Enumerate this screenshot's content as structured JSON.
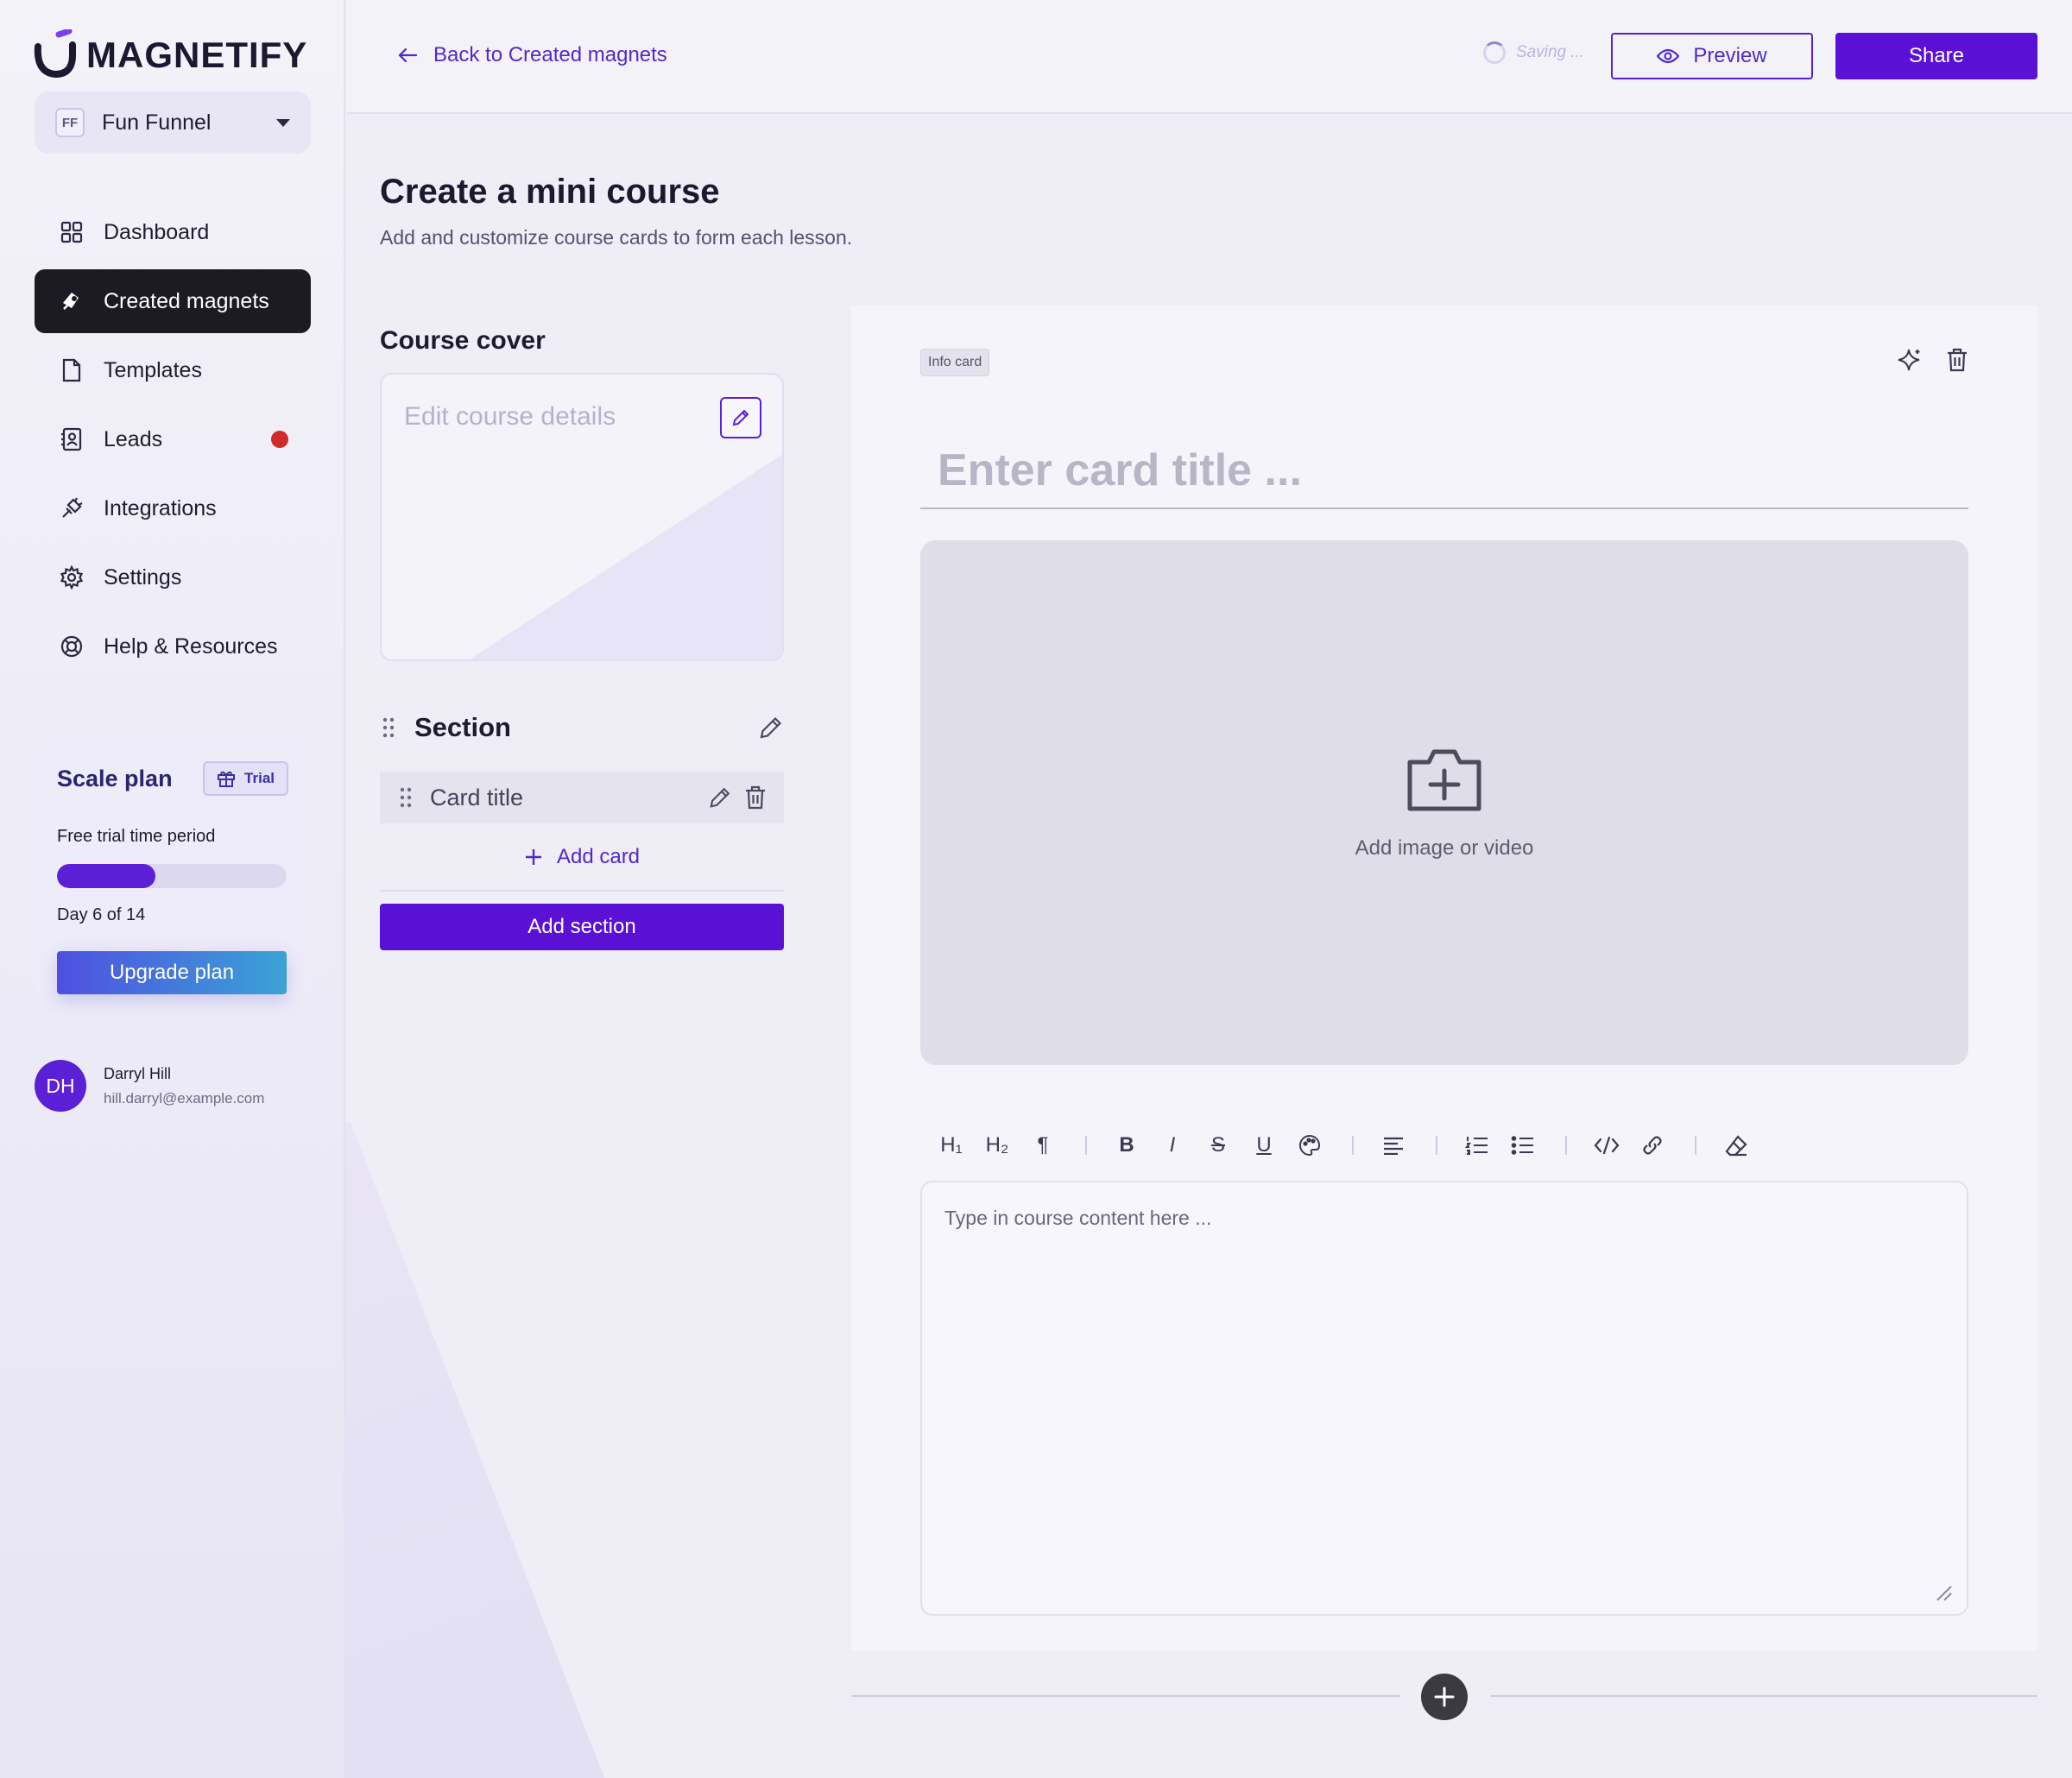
{
  "brand": {
    "name": "MAGNETIFY",
    "accent": "#5b10d6"
  },
  "workspace": {
    "initials": "FF",
    "name": "Fun Funnel"
  },
  "nav": {
    "items": [
      {
        "label": "Dashboard",
        "icon": "grid-icon",
        "active": false
      },
      {
        "label": "Created magnets",
        "icon": "magnet-icon",
        "active": true
      },
      {
        "label": "Templates",
        "icon": "document-icon",
        "active": false
      },
      {
        "label": "Leads",
        "icon": "contact-book-icon",
        "active": false,
        "has_notification": true
      },
      {
        "label": "Integrations",
        "icon": "plug-icon",
        "active": false
      },
      {
        "label": "Settings",
        "icon": "gear-icon",
        "active": false
      },
      {
        "label": "Help & Resources",
        "icon": "lifebuoy-icon",
        "active": false
      }
    ]
  },
  "plan": {
    "title": "Scale plan",
    "badge": "Trial",
    "subtitle": "Free trial time period",
    "progress_fraction": 0.43,
    "day_text": "Day 6 of 14",
    "upgrade_label": "Upgrade plan"
  },
  "user": {
    "initials": "DH",
    "name": "Darryl Hill",
    "email": "hill.darryl@example.com"
  },
  "topbar": {
    "back_label": "Back to Created magnets",
    "saving_text": "Saving ...",
    "preview_label": "Preview",
    "share_label": "Share"
  },
  "page": {
    "title": "Create a mini course",
    "subtitle": "Add and customize course cards to form each lesson."
  },
  "course": {
    "cover_label": "Course cover",
    "cover_placeholder": "Edit course details",
    "section_label": "Section",
    "card_title": "Card title",
    "add_card_label": "Add card",
    "add_section_label": "Add section"
  },
  "editor": {
    "card_type_badge": "Info card",
    "title_placeholder": "Enter card title ...",
    "media_label": "Add image or video",
    "content_placeholder": "Type in course content here ...",
    "toolbar": {
      "h1": "H₁",
      "h2": "H₂",
      "paragraph": "¶",
      "bold": "B",
      "italic": "I",
      "strike": "S",
      "underline": "U"
    }
  }
}
